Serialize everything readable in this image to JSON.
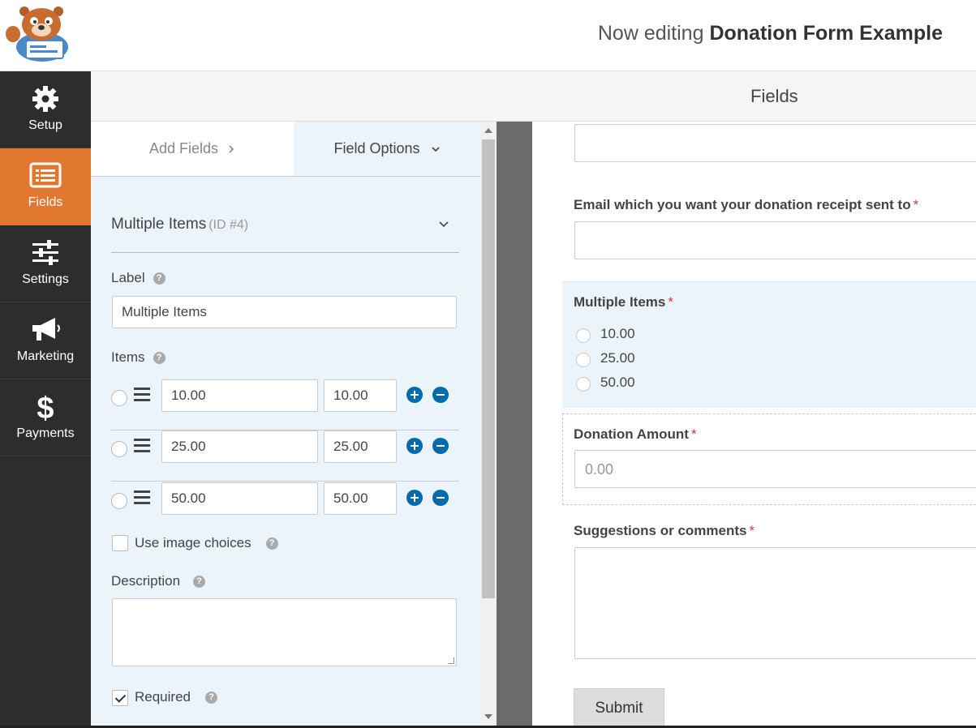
{
  "header": {
    "editing_prefix": "Now editing",
    "form_name": "Donation Form Example"
  },
  "nav": {
    "items": [
      {
        "label": "Setup",
        "icon": "gear-icon"
      },
      {
        "label": "Fields",
        "icon": "fields-list-icon",
        "active": true
      },
      {
        "label": "Settings",
        "icon": "sliders-icon"
      },
      {
        "label": "Marketing",
        "icon": "megaphone-icon"
      },
      {
        "label": "Payments",
        "icon": "dollar-icon"
      }
    ]
  },
  "fields_bar": {
    "title": "Fields"
  },
  "panel": {
    "tabs": {
      "add_fields": "Add Fields",
      "field_options": "Field Options"
    },
    "group": {
      "title": "Multiple Items",
      "id_text": "(ID #4)"
    },
    "label_label": "Label",
    "label_value": "Multiple Items",
    "items_label": "Items",
    "items": [
      {
        "name": "10.00",
        "value": "10.00"
      },
      {
        "name": "25.00",
        "value": "25.00"
      },
      {
        "name": "50.00",
        "value": "50.00"
      }
    ],
    "use_image_choices": "Use image choices",
    "description_label": "Description",
    "required_label": "Required",
    "help_glyph": "?"
  },
  "preview": {
    "email_label": "Email which you want your donation receipt sent to",
    "multiple_items_label": "Multiple Items",
    "options": [
      "10.00",
      "25.00",
      "50.00"
    ],
    "donation_label": "Donation Amount",
    "donation_placeholder": "0.00",
    "comments_label": "Suggestions or comments",
    "required_mark": "*",
    "submit": "Submit"
  },
  "colors": {
    "accent": "#e27730",
    "nav_bg": "#2d2d2d",
    "panel_bg": "#ebf3fb",
    "blue_button": "#036aab",
    "required": "#d63638"
  }
}
